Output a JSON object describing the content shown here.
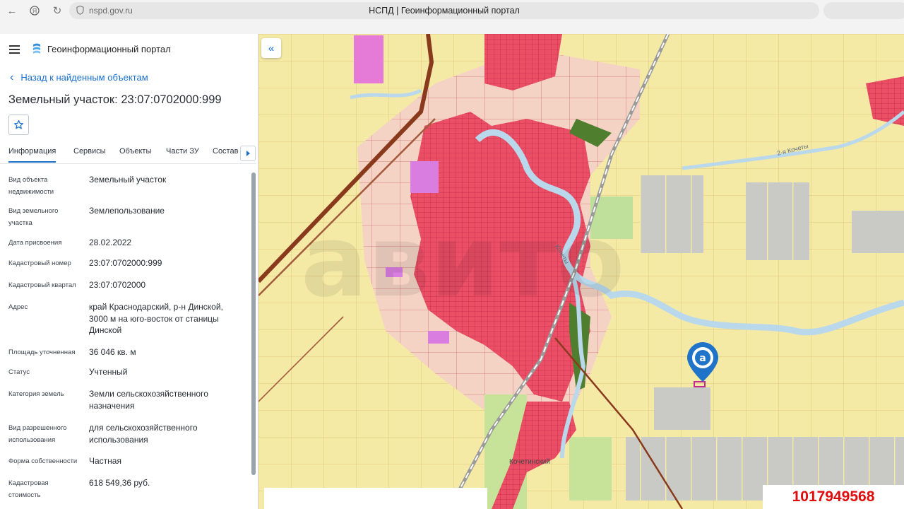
{
  "browser": {
    "url": "nspd.gov.ru",
    "tab_title": "НСПД | Геоинформационный портал"
  },
  "header": {
    "brand": "Геоинформационный портал"
  },
  "back_link": "Назад к найденным объектам",
  "page_title": "Земельный участок: 23:07:0702000:999",
  "tabs": [
    "Информация",
    "Сервисы",
    "Объекты",
    "Части ЗУ",
    "Состав"
  ],
  "active_tab": "Информация",
  "fields": [
    {
      "label": "Вид объекта недвижимости",
      "value": "Земельный участок"
    },
    {
      "label": "Вид земельного участка",
      "value": "Землепользование"
    },
    {
      "label": "Дата присвоения",
      "value": "28.02.2022"
    },
    {
      "label": "Кадастровый номер",
      "value": "23:07:0702000:999"
    },
    {
      "label": "Кадастровый квартал",
      "value": "23:07:0702000"
    },
    {
      "label": "Адрес",
      "value": "край Краснодарский, р-н Динской, 3000 м на юго-восток от станицы Динской"
    },
    {
      "label": "Площадь уточненная",
      "value": "36 046 кв. м"
    },
    {
      "label": "Статус",
      "value": "Учтенный"
    },
    {
      "label": "Категория земель",
      "value": "Земли сельскохозяйственного назначения"
    },
    {
      "label": "Вид разрешенного использования",
      "value": "для сельскохозяйственного использования"
    },
    {
      "label": "Форма собственности",
      "value": "Частная"
    },
    {
      "label": "Кадастровая стоимость",
      "value": "618 549,36 руб."
    }
  ],
  "map": {
    "labels": {
      "river_1": "2-я Кочеты",
      "river_2": "Кочеты",
      "settlement": "Кочетинский"
    },
    "marker_icon": "location-pin-icon",
    "colors": {
      "residential": "#e8455e",
      "farmland": "#f3e9a3",
      "river": "#b9d8ec",
      "industrial": "#cfcfcf",
      "commercial": "#e57bd7",
      "railway": "#8a3a1c"
    }
  },
  "overlay_id": "1017949568"
}
